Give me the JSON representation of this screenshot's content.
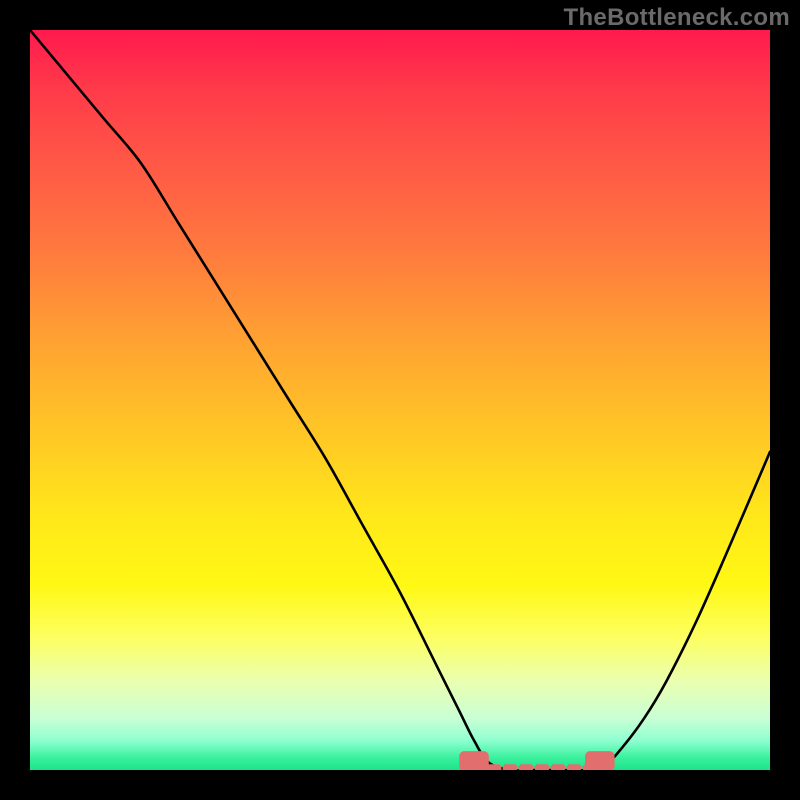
{
  "watermark": "TheBottleneck.com",
  "chart_data": {
    "type": "line",
    "title": "",
    "xlabel": "",
    "ylabel": "",
    "xlim": [
      0,
      100
    ],
    "ylim": [
      0,
      100
    ],
    "series": [
      {
        "name": "bottleneck-curve",
        "x": [
          0,
          5,
          10,
          15,
          20,
          25,
          30,
          35,
          40,
          45,
          50,
          55,
          58,
          60,
          62,
          65,
          68,
          70,
          72,
          75,
          78,
          80,
          83,
          86,
          90,
          94,
          100
        ],
        "values": [
          100,
          94,
          88,
          82,
          74,
          66,
          58,
          50,
          42,
          33,
          24,
          14,
          8,
          4,
          1,
          0,
          0,
          0,
          0,
          0,
          1,
          3,
          7,
          12,
          20,
          29,
          43
        ]
      }
    ],
    "annotations": [
      {
        "name": "marker-left",
        "x_range": [
          58,
          62
        ],
        "y": 1.2
      },
      {
        "name": "marker-right",
        "x_range": [
          75,
          79
        ],
        "y": 1.2
      }
    ],
    "baseline": {
      "name": "dashed-baseline",
      "x_range": [
        60,
        78
      ],
      "y": 0.3
    },
    "gradient_stops": [
      {
        "pos": 0,
        "color": "#ff1a4d"
      },
      {
        "pos": 0.08,
        "color": "#ff3a4a"
      },
      {
        "pos": 0.18,
        "color": "#ff5846"
      },
      {
        "pos": 0.3,
        "color": "#ff7a3e"
      },
      {
        "pos": 0.42,
        "color": "#ffa232"
      },
      {
        "pos": 0.55,
        "color": "#ffc825"
      },
      {
        "pos": 0.66,
        "color": "#ffe81a"
      },
      {
        "pos": 0.75,
        "color": "#fff814"
      },
      {
        "pos": 0.82,
        "color": "#fdff60"
      },
      {
        "pos": 0.88,
        "color": "#eaffb0"
      },
      {
        "pos": 0.93,
        "color": "#c9ffd4"
      },
      {
        "pos": 0.96,
        "color": "#8fffd0"
      },
      {
        "pos": 0.985,
        "color": "#35f09a"
      },
      {
        "pos": 1.0,
        "color": "#1ee38c"
      }
    ]
  }
}
